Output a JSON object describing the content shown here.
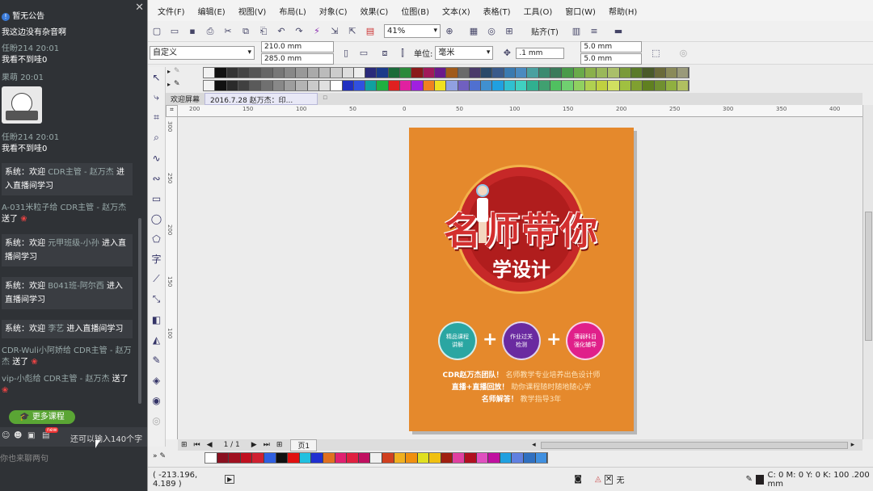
{
  "chat": {
    "notice": "暂无公告",
    "messages": [
      {
        "user": "",
        "time": "",
        "text": "我这边没有杂音啊"
      },
      {
        "user": "任盼214",
        "time": "20:01",
        "text": "我看不到哇0"
      },
      {
        "user": "果萌",
        "time": "20:01",
        "text": ""
      },
      {
        "user": "任盼214",
        "time": "20:01",
        "text": "我看不到哇0"
      }
    ],
    "system": [
      {
        "prefix": "系统：欢迎",
        "name": "CDR主管 - 赵万杰",
        "suffix": "进入直播间学习"
      },
      {
        "prefix": "系统：欢迎",
        "name": "元甲班级-小孙",
        "suffix": "进入直播间学习"
      },
      {
        "prefix": "系统：欢迎",
        "name": "B041班-阿尔西",
        "suffix": "进入直播间学习"
      },
      {
        "prefix": "系统：欢迎",
        "name": "李艺",
        "suffix": "进入直播间学习"
      }
    ],
    "gifts": [
      {
        "from": "A-031米粒子给",
        "to": "CDR主管 - 赵万杰",
        "suffix": "送了"
      },
      {
        "from": "CDR-Wuli小阿娇给",
        "to": "CDR主管 - 赵万杰",
        "suffix": "送了"
      },
      {
        "from": "vip-小彪给",
        "to": "CDR主管 - 赵万杰",
        "suffix": "送了"
      }
    ],
    "more_button": "更多课程",
    "input_hint": "还可以输入140个字",
    "input_placeholder": "你也来聊两句",
    "new_badge": "new"
  },
  "menu": [
    "文件(F)",
    "编辑(E)",
    "视图(V)",
    "布局(L)",
    "对象(C)",
    "效果(C)",
    "位图(B)",
    "文本(X)",
    "表格(T)",
    "工具(O)",
    "窗口(W)",
    "帮助(H)"
  ],
  "toolbar": {
    "zoom": "41%",
    "snap": "贴齐(T)"
  },
  "property": {
    "preset": "自定义",
    "width": "210.0 mm",
    "height": "285.0 mm",
    "unit_label": "单位:",
    "unit": "毫米",
    "nudge": ".1 mm",
    "dup_x": "5.0 mm",
    "dup_y": "5.0 mm"
  },
  "tabs": [
    "欢迎屏幕",
    "2016.7.28 赵万杰：印..."
  ],
  "hruler": [
    "200",
    "150",
    "100",
    "50",
    "0",
    "50",
    "100",
    "150",
    "200",
    "250",
    "300",
    "350",
    "400"
  ],
  "vruler": [
    "300",
    "250",
    "200",
    "150",
    "100"
  ],
  "pagebar": {
    "pages": "1 / 1",
    "page": "页1"
  },
  "status": {
    "coords": "( -213.196, 4.189 )",
    "fill": "无",
    "outline": "C: 0 M: 0 Y: 0 K: 100  .200 mm"
  },
  "poster": {
    "title": "名师带你",
    "subtitle": "学设计",
    "badges": [
      "精品课程\n讲解",
      "作业过关\n检测",
      "薄弱科目\n强化辅导"
    ],
    "line1a": "CDR赵万杰团队！",
    "line1b": "名师教学专业培养出色设计师",
    "line2a": "直播+直播回放！",
    "line2b": "助你课程随时随地随心学",
    "line3a": "名师解答！",
    "line3b": "教学指导3年"
  },
  "colors": {
    "accent": "#e5892c",
    "badge1": "#2aa6a2",
    "badge2": "#6a2aa0",
    "badge3": "#e0208a"
  }
}
